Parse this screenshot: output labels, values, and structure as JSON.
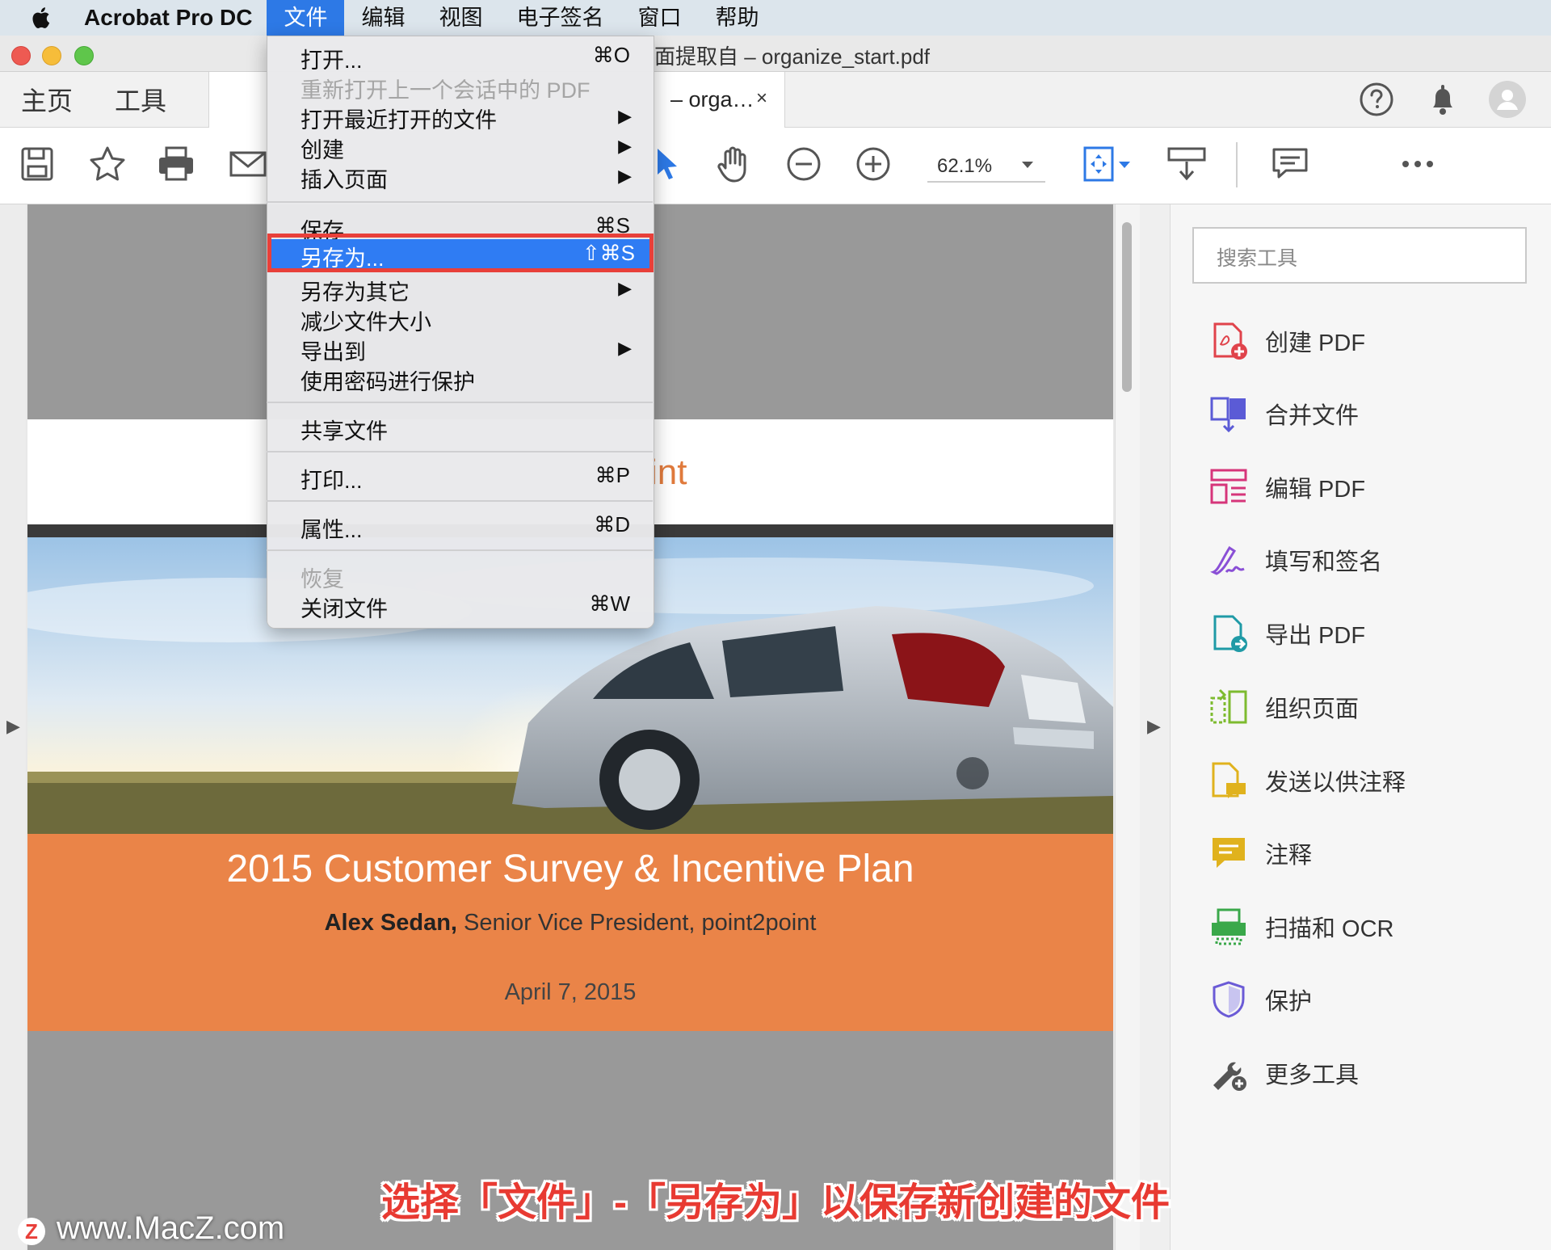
{
  "menubar": {
    "app_name": "Acrobat Pro DC",
    "menus": [
      "文件",
      "编辑",
      "视图",
      "电子签名",
      "窗口",
      "帮助"
    ]
  },
  "window": {
    "title": "面提取自 – organize_start.pdf"
  },
  "top_tabs": {
    "home": "主页",
    "tools": "工具",
    "document_tab": "– orga…",
    "close_glyph": "×"
  },
  "toolbar": {
    "zoom": "62.1%"
  },
  "file_menu": {
    "items": [
      {
        "label": "打开...",
        "shortcut": "⌘O"
      },
      {
        "label": "重新打开上一个会话中的 PDF",
        "disabled": true
      },
      {
        "label": "打开最近打开的文件",
        "submenu": true
      },
      {
        "label": "创建",
        "submenu": true
      },
      {
        "label": "插入页面",
        "submenu": true
      },
      {
        "label": "保存",
        "shortcut": "⌘S"
      },
      {
        "label": "另存为...",
        "shortcut": "⇧⌘S",
        "selected": true
      },
      {
        "label": "另存为其它",
        "submenu": true
      },
      {
        "label": "减少文件大小"
      },
      {
        "label": "导出到",
        "submenu": true
      },
      {
        "label": "使用密码进行保护"
      },
      {
        "label": "共享文件"
      },
      {
        "label": "打印...",
        "shortcut": "⌘P"
      },
      {
        "label": "属性...",
        "shortcut": "⌘D"
      },
      {
        "label": "恢复",
        "disabled": true
      },
      {
        "label": "关闭文件",
        "shortcut": "⌘W"
      }
    ]
  },
  "document": {
    "header_fragment": "int",
    "title": "2015 Customer Survey & Incentive Plan",
    "presenter_name": "Alex Sedan,",
    "presenter_role": " Senior Vice President, point2point",
    "date": "April 7, 2015"
  },
  "tools_pane": {
    "search_placeholder": "搜索工具",
    "items": [
      {
        "label": "创建 PDF",
        "icon": "create-pdf-icon",
        "color": "#e0434b"
      },
      {
        "label": "合并文件",
        "icon": "combine-files-icon",
        "color": "#5b5bd6"
      },
      {
        "label": "编辑 PDF",
        "icon": "edit-pdf-icon",
        "color": "#d6357a"
      },
      {
        "label": "填写和签名",
        "icon": "fill-sign-icon",
        "color": "#8a4fd6"
      },
      {
        "label": "导出 PDF",
        "icon": "export-pdf-icon",
        "color": "#1f9aa6"
      },
      {
        "label": "组织页面",
        "icon": "organize-pages-icon",
        "color": "#7dbb2f"
      },
      {
        "label": "发送以供注释",
        "icon": "send-comments-icon",
        "color": "#e0b21d"
      },
      {
        "label": "注释",
        "icon": "comment-icon",
        "color": "#e0b21d"
      },
      {
        "label": "扫描和 OCR",
        "icon": "scan-ocr-icon",
        "color": "#3aa84a"
      },
      {
        "label": "保护",
        "icon": "protect-icon",
        "color": "#6b5bd6"
      },
      {
        "label": "更多工具",
        "icon": "more-tools-icon",
        "color": "#555555"
      }
    ]
  },
  "caption": "选择「文件」-「另存为」以保存新创建的文件",
  "watermark": "www.MacZ.com",
  "watermark_logo": "Z"
}
